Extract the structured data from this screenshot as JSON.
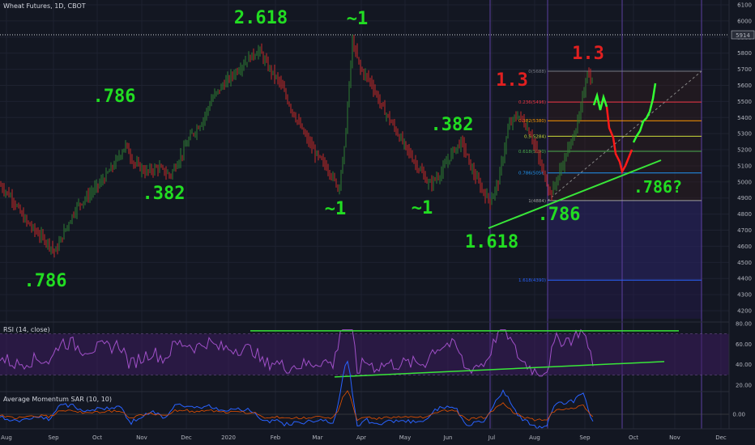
{
  "header": {
    "symbol_line": "Wheat Futures, 1D, CBOT"
  },
  "price_axis": {
    "ticks": [
      "6100",
      "6000",
      "5900",
      "5800",
      "5700",
      "5600",
      "5500",
      "5400",
      "5300",
      "5200",
      "5100",
      "5000",
      "4900",
      "4800",
      "4700",
      "4600",
      "4500",
      "4400",
      "4300",
      "4200"
    ],
    "current_price": "5914"
  },
  "time_axis": {
    "labels": [
      "Aug",
      "Sep",
      "Oct",
      "Nov",
      "Dec",
      "2020",
      "Feb",
      "Mar",
      "Apr",
      "May",
      "Jun",
      "Jul",
      "Aug",
      "Sep",
      "Oct",
      "Nov",
      "Dec"
    ]
  },
  "rsi": {
    "title": "RSI (14, close)",
    "ticks": [
      "80.00",
      "60.00",
      "40.00",
      "20.00"
    ]
  },
  "sar": {
    "title": "Average Momentum SAR (10, 10)",
    "ticks": [
      "0.00"
    ]
  },
  "fib": {
    "levels": [
      {
        "ratio": "0",
        "price": "5688",
        "label": "0(5688)",
        "color": "#787b86"
      },
      {
        "ratio": "0.236",
        "price": "5496",
        "label": "0.236(5496)",
        "color": "#f23645"
      },
      {
        "ratio": "0.382",
        "price": "5380",
        "label": "0.382(5380)",
        "color": "#ff9800"
      },
      {
        "ratio": "0.5",
        "price": "5284",
        "label": "0.5(5284)",
        "color": "#cddc39"
      },
      {
        "ratio": "0.618",
        "price": "5190",
        "label": "0.618(5190)",
        "color": "#4caf50"
      },
      {
        "ratio": "0.786",
        "price": "5056",
        "label": "0.786(5056)",
        "color": "#2196f3"
      },
      {
        "ratio": "1",
        "price": "4884",
        "label": "1(4884)",
        "color": "#9e9e9e"
      },
      {
        "ratio": "1.618",
        "price": "4390",
        "label": "1.618(4390)",
        "color": "#2962ff"
      }
    ]
  },
  "annotations": [
    {
      "text": ".786",
      "color": "#22dd22",
      "size": 22
    },
    {
      "text": ".786",
      "color": "#22dd22",
      "size": 22
    },
    {
      "text": ".382",
      "color": "#22dd22",
      "size": 22
    },
    {
      "text": "2.618",
      "color": "#22dd22",
      "size": 22
    },
    {
      "text": "~1",
      "color": "#22dd22",
      "size": 22
    },
    {
      "text": "~1",
      "color": "#22dd22",
      "size": 22
    },
    {
      "text": "~1",
      "color": "#22dd22",
      "size": 22
    },
    {
      "text": ".382",
      "color": "#22dd22",
      "size": 22
    },
    {
      "text": "1.618",
      "color": "#22dd22",
      "size": 22
    },
    {
      "text": ".786",
      "color": "#22dd22",
      "size": 22
    },
    {
      "text": "1.3",
      "color": "#e02020",
      "size": 22
    },
    {
      "text": "1.3",
      "color": "#e02020",
      "size": 22
    },
    {
      "text": ".786?",
      "color": "#22dd22",
      "size": 20
    }
  ],
  "colors": {
    "background": "#131722",
    "grid": "#1e2230",
    "up": "#26a69a",
    "down": "#ef5350",
    "bar_up": "#2e7d32",
    "bar_down": "#c62828",
    "rsi": "#9c27b0",
    "rsi_band": "#4a148c",
    "trend_green": "#39e639",
    "proj_red": "#ff1a1a",
    "proj_green": "#33ff33",
    "axis_text": "#b2b5be"
  },
  "chart_data": {
    "type": "ohlc",
    "title": "Wheat Futures, 1D, CBOT",
    "x": [
      "Aug",
      "Sep",
      "Oct",
      "Nov",
      "Dec",
      "2020",
      "Feb",
      "Mar",
      "Apr",
      "May",
      "Jun",
      "Jul",
      "Aug",
      "Sep",
      "Oct",
      "Nov",
      "Dec"
    ],
    "ylim": [
      4150,
      6150
    ],
    "close_path": [
      {
        "x": "Aug",
        "y": 4980
      },
      {
        "x": "Aug",
        "y": 4780
      },
      {
        "x": "Sep",
        "y": 4620
      },
      {
        "x": "Sep",
        "y": 4850
      },
      {
        "x": "Oct",
        "y": 5000
      },
      {
        "x": "Oct",
        "y": 5180
      },
      {
        "x": "Nov",
        "y": 5080
      },
      {
        "x": "Nov",
        "y": 5020
      },
      {
        "x": "Dec",
        "y": 5200
      },
      {
        "x": "Dec",
        "y": 5350
      },
      {
        "x": "2020",
        "y": 5650
      },
      {
        "x": "2020",
        "y": 5820
      },
      {
        "x": "Feb",
        "y": 5700
      },
      {
        "x": "Feb",
        "y": 5400
      },
      {
        "x": "Mar",
        "y": 5150
      },
      {
        "x": "Mar",
        "y": 4960
      },
      {
        "x": "Apr",
        "y": 5870
      },
      {
        "x": "Apr",
        "y": 5600
      },
      {
        "x": "May",
        "y": 5300
      },
      {
        "x": "May",
        "y": 5100
      },
      {
        "x": "Jun",
        "y": 4980
      },
      {
        "x": "Jun",
        "y": 5250
      },
      {
        "x": "Jul",
        "y": 4880
      },
      {
        "x": "Jul",
        "y": 5400
      },
      {
        "x": "Aug",
        "y": 4910
      },
      {
        "x": "Aug",
        "y": 5350
      },
      {
        "x": "Sep",
        "y": 5688
      }
    ],
    "fib_retracement": [
      {
        "level": 0,
        "price": 5688
      },
      {
        "level": 0.236,
        "price": 5496
      },
      {
        "level": 0.382,
        "price": 5380
      },
      {
        "level": 0.5,
        "price": 5284
      },
      {
        "level": 0.618,
        "price": 5190
      },
      {
        "level": 0.786,
        "price": 5056
      },
      {
        "level": 1,
        "price": 4884
      },
      {
        "level": 1.618,
        "price": 4390
      }
    ],
    "projection": [
      {
        "segment": "green",
        "points": [
          5500,
          5450,
          5480,
          5400,
          5470
        ]
      },
      {
        "segment": "red",
        "points": [
          5380,
          5200,
          5150,
          5060,
          5100,
          5150,
          5200
        ]
      },
      {
        "segment": "green",
        "points": [
          5280,
          5330,
          5400,
          5480,
          5620
        ]
      }
    ],
    "rsi_range": [
      20,
      80
    ],
    "rsi_trendlines": {
      "upper": 72,
      "lower_start": 28,
      "lower_end": 43
    }
  }
}
